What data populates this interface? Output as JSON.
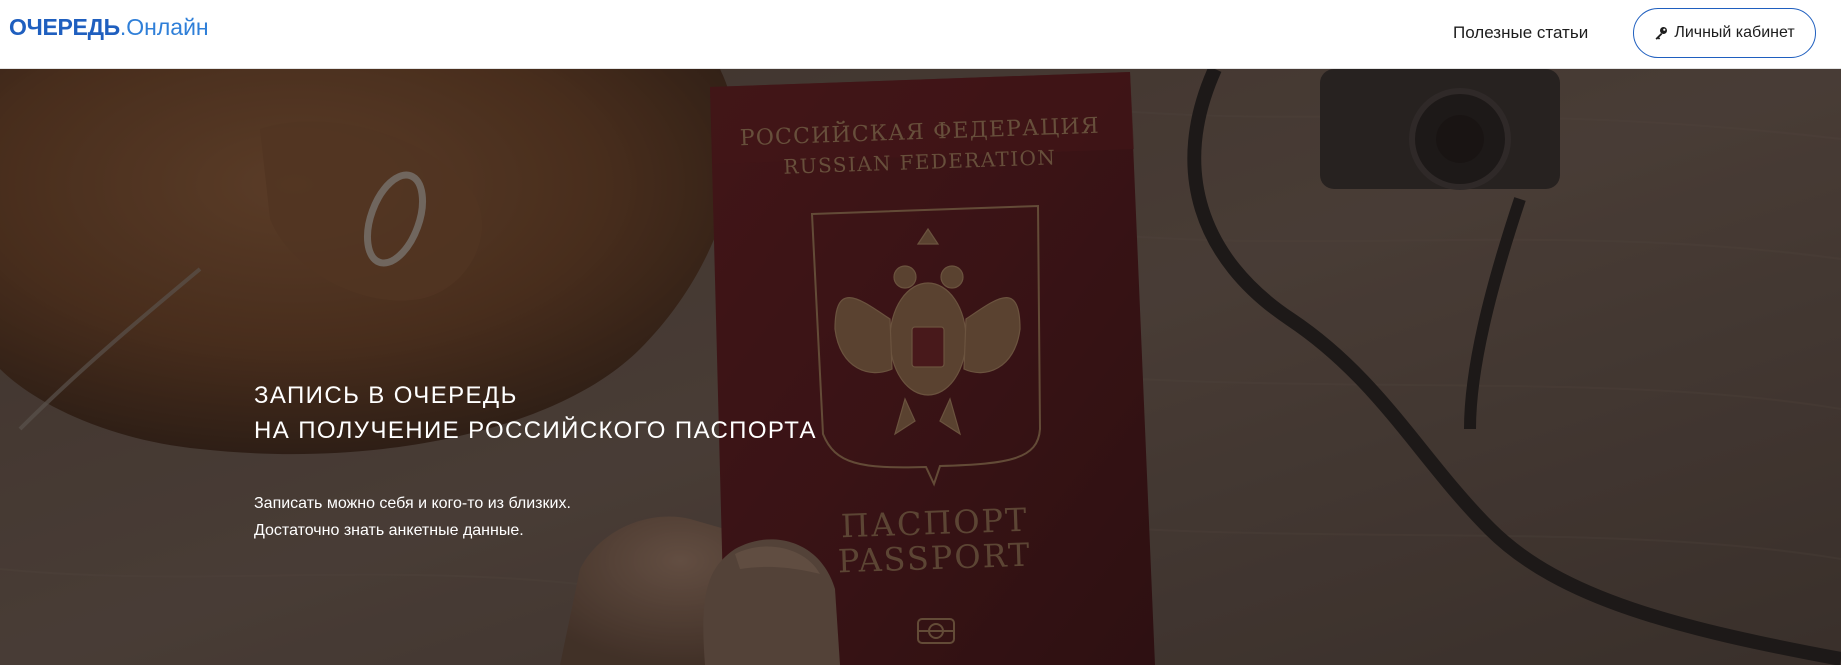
{
  "header": {
    "logo": {
      "bold": "ОЧЕРЕДЬ",
      "light": ".Онлайн"
    },
    "nav": {
      "articles_label": "Полезные статьи"
    },
    "cabinet": {
      "label": "Личный кабинет",
      "icon": "key-icon"
    }
  },
  "hero": {
    "title_line1": "ЗАПИСЬ В ОЧЕРЕДЬ",
    "title_line2": "НА ПОЛУЧЕНИЕ РОССИЙСКОГО ПАСПОРТА",
    "subtitle_line1": "Записать можно себя и кого-то из близких.",
    "subtitle_line2": "Достаточно знать анкетные данные.",
    "passport": {
      "top_line1": "РОССИЙСКАЯ ФЕДЕРАЦИЯ",
      "top_line2": "RUSSIAN FEDERATION",
      "bottom_line1": "ПАСПОРТ",
      "bottom_line2": "PASSPORT"
    }
  },
  "colors": {
    "brand": "#1f5fbf",
    "hero_overlay": "#2a2220",
    "passport_red": "#5a1218",
    "passport_gold": "#a07a55"
  }
}
